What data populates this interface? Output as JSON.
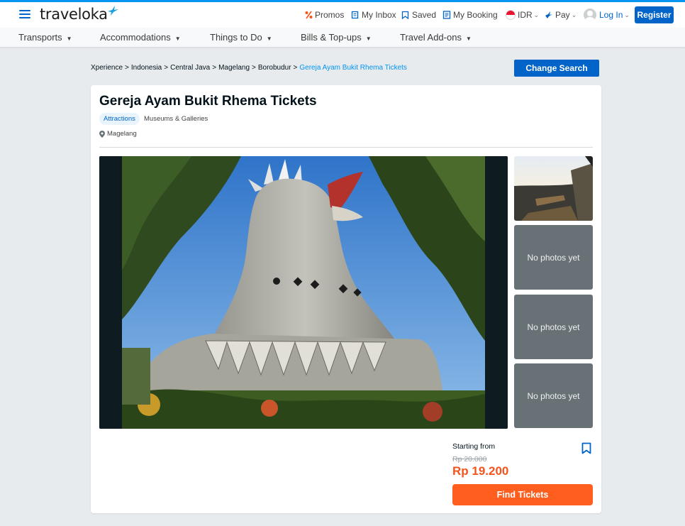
{
  "header": {
    "logo_text": "traveloka",
    "nav": {
      "promos": "Promos",
      "inbox": "My Inbox",
      "saved": "Saved",
      "booking": "My Booking",
      "currency": "IDR",
      "pay": "Pay",
      "login": "Log In",
      "register": "Register"
    }
  },
  "subnav": {
    "items": [
      "Transports",
      "Accommodations",
      "Things to Do",
      "Bills & Top-ups",
      "Travel Add-ons"
    ]
  },
  "breadcrumb": {
    "items": [
      "Xperience",
      "Indonesia",
      "Central Java",
      "Magelang",
      "Borobudur"
    ],
    "current": "Gereja Ayam Bukit Rhema Tickets"
  },
  "change_search_label": "Change Search",
  "attraction": {
    "title": "Gereja Ayam Bukit Rhema Tickets",
    "tags": [
      "Attractions",
      "Museums & Galleries"
    ],
    "location": "Magelang"
  },
  "gallery": {
    "empty_label": "No photos yet"
  },
  "pricing": {
    "starting_label": "Starting from",
    "original_price": "Rp 20.000",
    "price": "Rp 19.200",
    "cta": "Find Tickets"
  },
  "colors": {
    "brand_blue": "#0264c8",
    "accent_blue": "#0194f3",
    "orange": "#ff5e1f",
    "price_orange": "#f2541b"
  }
}
